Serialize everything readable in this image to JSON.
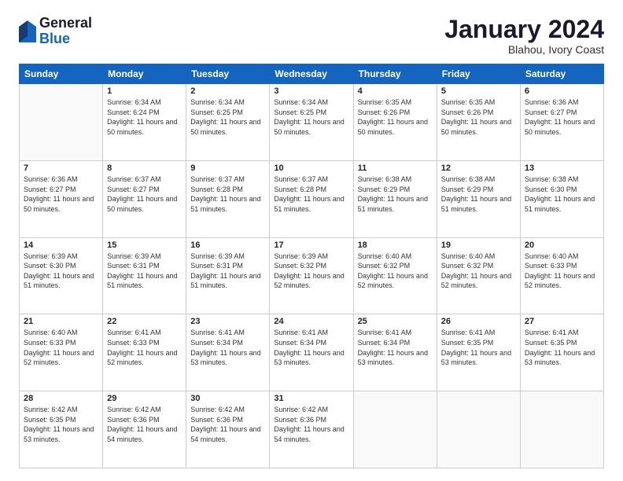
{
  "logo": {
    "general": "General",
    "blue": "Blue"
  },
  "title": "January 2024",
  "location": "Blahou, Ivory Coast",
  "days_header": [
    "Sunday",
    "Monday",
    "Tuesday",
    "Wednesday",
    "Thursday",
    "Friday",
    "Saturday"
  ],
  "weeks": [
    [
      {
        "day": "",
        "sunrise": "",
        "sunset": "",
        "daylight": ""
      },
      {
        "day": "1",
        "sunrise": "Sunrise: 6:34 AM",
        "sunset": "Sunset: 6:24 PM",
        "daylight": "Daylight: 11 hours and 50 minutes."
      },
      {
        "day": "2",
        "sunrise": "Sunrise: 6:34 AM",
        "sunset": "Sunset: 6:25 PM",
        "daylight": "Daylight: 11 hours and 50 minutes."
      },
      {
        "day": "3",
        "sunrise": "Sunrise: 6:34 AM",
        "sunset": "Sunset: 6:25 PM",
        "daylight": "Daylight: 11 hours and 50 minutes."
      },
      {
        "day": "4",
        "sunrise": "Sunrise: 6:35 AM",
        "sunset": "Sunset: 6:26 PM",
        "daylight": "Daylight: 11 hours and 50 minutes."
      },
      {
        "day": "5",
        "sunrise": "Sunrise: 6:35 AM",
        "sunset": "Sunset: 6:26 PM",
        "daylight": "Daylight: 11 hours and 50 minutes."
      },
      {
        "day": "6",
        "sunrise": "Sunrise: 6:36 AM",
        "sunset": "Sunset: 6:27 PM",
        "daylight": "Daylight: 11 hours and 50 minutes."
      }
    ],
    [
      {
        "day": "7",
        "sunrise": "Sunrise: 6:36 AM",
        "sunset": "Sunset: 6:27 PM",
        "daylight": "Daylight: 11 hours and 50 minutes."
      },
      {
        "day": "8",
        "sunrise": "Sunrise: 6:37 AM",
        "sunset": "Sunset: 6:27 PM",
        "daylight": "Daylight: 11 hours and 50 minutes."
      },
      {
        "day": "9",
        "sunrise": "Sunrise: 6:37 AM",
        "sunset": "Sunset: 6:28 PM",
        "daylight": "Daylight: 11 hours and 51 minutes."
      },
      {
        "day": "10",
        "sunrise": "Sunrise: 6:37 AM",
        "sunset": "Sunset: 6:28 PM",
        "daylight": "Daylight: 11 hours and 51 minutes."
      },
      {
        "day": "11",
        "sunrise": "Sunrise: 6:38 AM",
        "sunset": "Sunset: 6:29 PM",
        "daylight": "Daylight: 11 hours and 51 minutes."
      },
      {
        "day": "12",
        "sunrise": "Sunrise: 6:38 AM",
        "sunset": "Sunset: 6:29 PM",
        "daylight": "Daylight: 11 hours and 51 minutes."
      },
      {
        "day": "13",
        "sunrise": "Sunrise: 6:38 AM",
        "sunset": "Sunset: 6:30 PM",
        "daylight": "Daylight: 11 hours and 51 minutes."
      }
    ],
    [
      {
        "day": "14",
        "sunrise": "Sunrise: 6:39 AM",
        "sunset": "Sunset: 6:30 PM",
        "daylight": "Daylight: 11 hours and 51 minutes."
      },
      {
        "day": "15",
        "sunrise": "Sunrise: 6:39 AM",
        "sunset": "Sunset: 6:31 PM",
        "daylight": "Daylight: 11 hours and 51 minutes."
      },
      {
        "day": "16",
        "sunrise": "Sunrise: 6:39 AM",
        "sunset": "Sunset: 6:31 PM",
        "daylight": "Daylight: 11 hours and 51 minutes."
      },
      {
        "day": "17",
        "sunrise": "Sunrise: 6:39 AM",
        "sunset": "Sunset: 6:32 PM",
        "daylight": "Daylight: 11 hours and 52 minutes."
      },
      {
        "day": "18",
        "sunrise": "Sunrise: 6:40 AM",
        "sunset": "Sunset: 6:32 PM",
        "daylight": "Daylight: 11 hours and 52 minutes."
      },
      {
        "day": "19",
        "sunrise": "Sunrise: 6:40 AM",
        "sunset": "Sunset: 6:32 PM",
        "daylight": "Daylight: 11 hours and 52 minutes."
      },
      {
        "day": "20",
        "sunrise": "Sunrise: 6:40 AM",
        "sunset": "Sunset: 6:33 PM",
        "daylight": "Daylight: 11 hours and 52 minutes."
      }
    ],
    [
      {
        "day": "21",
        "sunrise": "Sunrise: 6:40 AM",
        "sunset": "Sunset: 6:33 PM",
        "daylight": "Daylight: 11 hours and 52 minutes."
      },
      {
        "day": "22",
        "sunrise": "Sunrise: 6:41 AM",
        "sunset": "Sunset: 6:33 PM",
        "daylight": "Daylight: 11 hours and 52 minutes."
      },
      {
        "day": "23",
        "sunrise": "Sunrise: 6:41 AM",
        "sunset": "Sunset: 6:34 PM",
        "daylight": "Daylight: 11 hours and 53 minutes."
      },
      {
        "day": "24",
        "sunrise": "Sunrise: 6:41 AM",
        "sunset": "Sunset: 6:34 PM",
        "daylight": "Daylight: 11 hours and 53 minutes."
      },
      {
        "day": "25",
        "sunrise": "Sunrise: 6:41 AM",
        "sunset": "Sunset: 6:34 PM",
        "daylight": "Daylight: 11 hours and 53 minutes."
      },
      {
        "day": "26",
        "sunrise": "Sunrise: 6:41 AM",
        "sunset": "Sunset: 6:35 PM",
        "daylight": "Daylight: 11 hours and 53 minutes."
      },
      {
        "day": "27",
        "sunrise": "Sunrise: 6:41 AM",
        "sunset": "Sunset: 6:35 PM",
        "daylight": "Daylight: 11 hours and 53 minutes."
      }
    ],
    [
      {
        "day": "28",
        "sunrise": "Sunrise: 6:42 AM",
        "sunset": "Sunset: 6:35 PM",
        "daylight": "Daylight: 11 hours and 53 minutes."
      },
      {
        "day": "29",
        "sunrise": "Sunrise: 6:42 AM",
        "sunset": "Sunset: 6:36 PM",
        "daylight": "Daylight: 11 hours and 54 minutes."
      },
      {
        "day": "30",
        "sunrise": "Sunrise: 6:42 AM",
        "sunset": "Sunset: 6:36 PM",
        "daylight": "Daylight: 11 hours and 54 minutes."
      },
      {
        "day": "31",
        "sunrise": "Sunrise: 6:42 AM",
        "sunset": "Sunset: 6:36 PM",
        "daylight": "Daylight: 11 hours and 54 minutes."
      },
      {
        "day": "",
        "sunrise": "",
        "sunset": "",
        "daylight": ""
      },
      {
        "day": "",
        "sunrise": "",
        "sunset": "",
        "daylight": ""
      },
      {
        "day": "",
        "sunrise": "",
        "sunset": "",
        "daylight": ""
      }
    ]
  ]
}
